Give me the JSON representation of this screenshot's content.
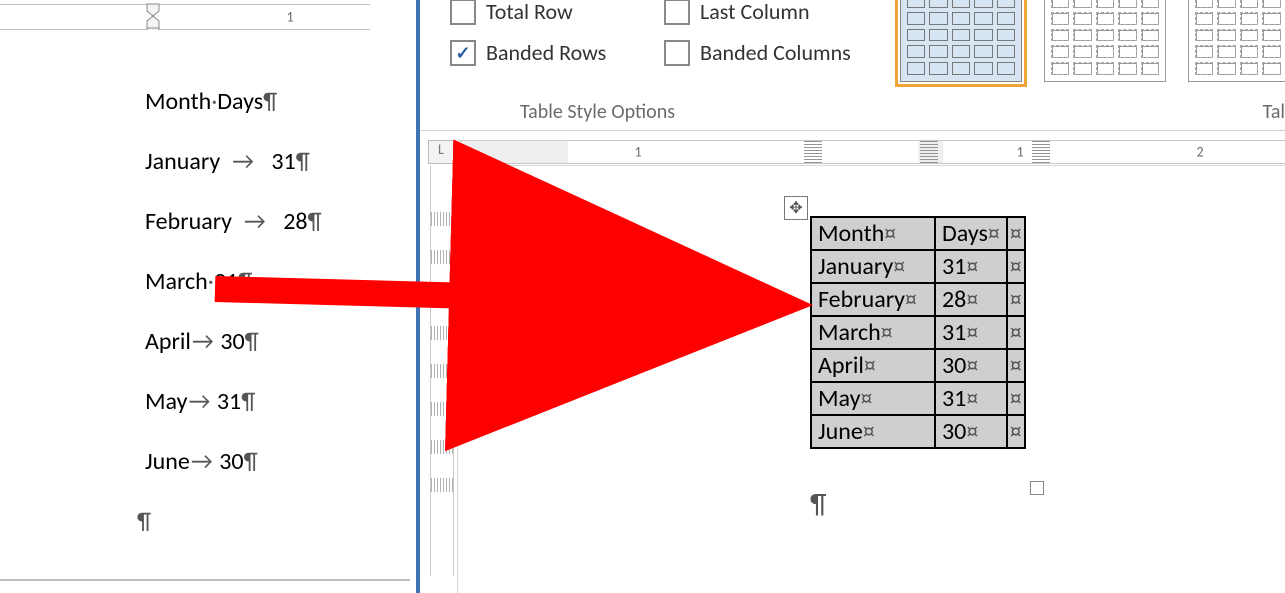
{
  "marks": {
    "pilcrow": "¶",
    "tab_arrow": "→",
    "cell_end": "¤",
    "move_handle": "✥",
    "corner": "L"
  },
  "left_ruler": {
    "label_1": "1"
  },
  "left_doc": {
    "header": {
      "a": "Month",
      "b": "Days"
    },
    "rows": [
      {
        "a": "January",
        "sep": "wide_tab",
        "b": "31"
      },
      {
        "a": "February",
        "sep": "wide_tab",
        "b": "28"
      },
      {
        "a": "March",
        "sep": "dot",
        "b": "31"
      },
      {
        "a": "April",
        "sep": "tab",
        "b": "30"
      },
      {
        "a": "May",
        "sep": "tab",
        "b": "31"
      },
      {
        "a": "June",
        "sep": "tab",
        "b": "30"
      }
    ]
  },
  "ribbon": {
    "options": {
      "total_row": {
        "label": "Total Row",
        "checked": false
      },
      "last_column": {
        "label": "Last Column",
        "checked": false
      },
      "banded_rows": {
        "label": "Banded Rows",
        "checked": true
      },
      "banded_columns": {
        "label": "Banded Columns",
        "checked": false
      }
    },
    "group1_label": "Table Style Options",
    "group2_label": "Tal"
  },
  "right_ruler": {
    "n1": "1",
    "n1b": "1",
    "n2": "2"
  },
  "table": {
    "header": {
      "a": "Month",
      "b": "Days"
    },
    "rows": [
      {
        "a": "January",
        "b": "31"
      },
      {
        "a": "February",
        "b": "28"
      },
      {
        "a": "March",
        "b": "31"
      },
      {
        "a": "April",
        "b": "30"
      },
      {
        "a": "May",
        "b": "31"
      },
      {
        "a": "June",
        "b": "30"
      }
    ]
  }
}
